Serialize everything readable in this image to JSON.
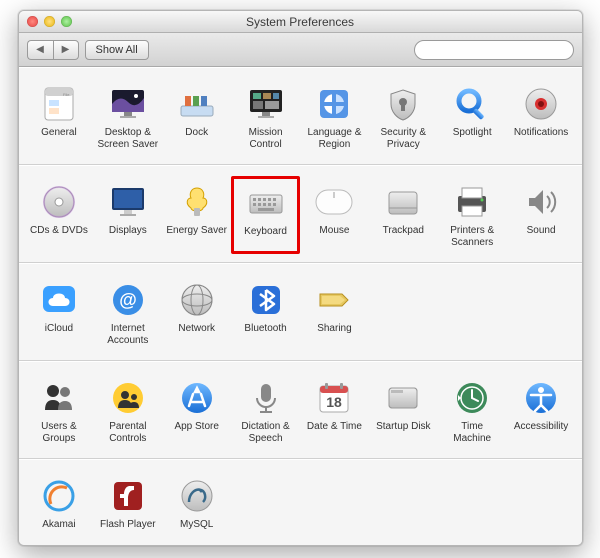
{
  "window": {
    "title": "System Preferences"
  },
  "toolbar": {
    "back": "◀",
    "forward": "▶",
    "show_all": "Show All",
    "search_placeholder": ""
  },
  "rows": [
    [
      {
        "id": "general",
        "label": "General"
      },
      {
        "id": "desktop",
        "label": "Desktop & Screen Saver"
      },
      {
        "id": "dock",
        "label": "Dock"
      },
      {
        "id": "mission",
        "label": "Mission Control"
      },
      {
        "id": "language",
        "label": "Language & Region"
      },
      {
        "id": "security",
        "label": "Security & Privacy"
      },
      {
        "id": "spotlight",
        "label": "Spotlight"
      },
      {
        "id": "notifications",
        "label": "Notifications"
      }
    ],
    [
      {
        "id": "cds",
        "label": "CDs & DVDs"
      },
      {
        "id": "displays",
        "label": "Displays"
      },
      {
        "id": "energy",
        "label": "Energy Saver"
      },
      {
        "id": "keyboard",
        "label": "Keyboard",
        "highlight": true
      },
      {
        "id": "mouse",
        "label": "Mouse"
      },
      {
        "id": "trackpad",
        "label": "Trackpad"
      },
      {
        "id": "printers",
        "label": "Printers & Scanners"
      },
      {
        "id": "sound",
        "label": "Sound"
      }
    ],
    [
      {
        "id": "icloud",
        "label": "iCloud"
      },
      {
        "id": "internet",
        "label": "Internet Accounts"
      },
      {
        "id": "network",
        "label": "Network"
      },
      {
        "id": "bluetooth",
        "label": "Bluetooth"
      },
      {
        "id": "sharing",
        "label": "Sharing"
      }
    ],
    [
      {
        "id": "users",
        "label": "Users & Groups"
      },
      {
        "id": "parental",
        "label": "Parental Controls"
      },
      {
        "id": "appstore",
        "label": "App Store"
      },
      {
        "id": "dictation",
        "label": "Dictation & Speech"
      },
      {
        "id": "datetime",
        "label": "Date & Time"
      },
      {
        "id": "startup",
        "label": "Startup Disk"
      },
      {
        "id": "timemachine",
        "label": "Time Machine"
      },
      {
        "id": "accessibility",
        "label": "Accessibility"
      }
    ],
    [
      {
        "id": "akamai",
        "label": "Akamai"
      },
      {
        "id": "flash",
        "label": "Flash Player"
      },
      {
        "id": "mysql",
        "label": "MySQL"
      }
    ]
  ]
}
